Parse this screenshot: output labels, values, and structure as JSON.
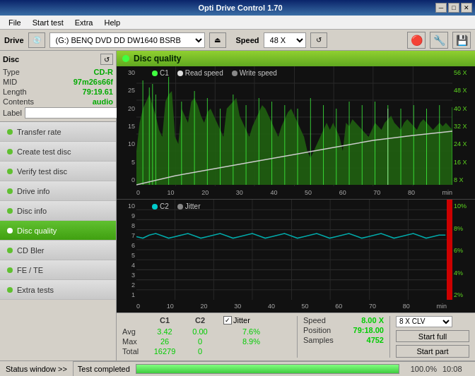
{
  "titleBar": {
    "title": "Opti Drive Control 1.70",
    "minBtn": "─",
    "maxBtn": "□",
    "closeBtn": "✕"
  },
  "menuBar": {
    "items": [
      "File",
      "Start test",
      "Extra",
      "Help"
    ]
  },
  "driveBar": {
    "driveLabel": "Drive",
    "driveValue": "(G:)  BENQ DVD DD DW1640 BSRB",
    "speedLabel": "Speed",
    "speedValue": "48 X"
  },
  "leftPanel": {
    "discSection": {
      "label": "Disc",
      "typeLabel": "Type",
      "typeValue": "CD-R",
      "midLabel": "MID",
      "midValue": "97m26s66f",
      "lengthLabel": "Length",
      "lengthValue": "79:19.61",
      "contentsLabel": "Contents",
      "contentsValue": "audio",
      "labelLabel": "Label",
      "labelValue": ""
    },
    "navItems": [
      {
        "label": "Transfer rate",
        "active": false
      },
      {
        "label": "Create test disc",
        "active": false
      },
      {
        "label": "Verify test disc",
        "active": false
      },
      {
        "label": "Drive info",
        "active": false
      },
      {
        "label": "Disc info",
        "active": false
      },
      {
        "label": "Disc quality",
        "active": true
      },
      {
        "label": "CD Bler",
        "active": false
      },
      {
        "label": "FE / TE",
        "active": false
      },
      {
        "label": "Extra tests",
        "active": false
      }
    ]
  },
  "chartArea": {
    "title": "Disc quality",
    "topChart": {
      "legend": [
        {
          "label": "C1",
          "color": "#40ff40"
        },
        {
          "label": "Read speed",
          "color": "#dddddd"
        },
        {
          "label": "Write speed",
          "color": "#888888"
        }
      ],
      "yLabels": [
        "30",
        "25",
        "20",
        "15",
        "10",
        "5",
        "0"
      ],
      "yRightLabels": [
        "56 X",
        "48 X",
        "40 X",
        "32 X",
        "24 X",
        "16 X",
        "8 X"
      ],
      "xLabels": [
        "0",
        "10",
        "20",
        "30",
        "40",
        "50",
        "60",
        "70",
        "80"
      ],
      "xUnit": "min"
    },
    "bottomChart": {
      "legend": [
        {
          "label": "C2",
          "color": "#00cccc"
        },
        {
          "label": "Jitter",
          "color": "#888888"
        }
      ],
      "yLabels": [
        "10",
        "9",
        "8",
        "7",
        "6",
        "5",
        "4",
        "3",
        "2",
        "1"
      ],
      "yRightLabels": [
        "10%",
        "8%",
        "6%",
        "4%",
        "2%"
      ],
      "xLabels": [
        "0",
        "10",
        "20",
        "30",
        "40",
        "50",
        "60",
        "70",
        "80"
      ],
      "xUnit": "min"
    }
  },
  "statsBar": {
    "headers": [
      "",
      "C1",
      "C2"
    ],
    "rows": [
      {
        "label": "Avg",
        "c1": "3.42",
        "c2": "0.00",
        "jitter": "7.6%"
      },
      {
        "label": "Max",
        "c1": "26",
        "c2": "0",
        "jitter": "8.9%"
      },
      {
        "label": "Total",
        "c1": "16279",
        "c2": "0",
        "jitter": ""
      }
    ],
    "jitterLabel": "Jitter",
    "jitterChecked": true,
    "speedLabel": "Speed",
    "speedValue": "8.00 X",
    "positionLabel": "Position",
    "positionValue": "79:18.00",
    "samplesLabel": "Samples",
    "samplesValue": "4752",
    "clvValue": "8 X CLV",
    "startFullLabel": "Start full",
    "startPartLabel": "Start part"
  },
  "statusBar": {
    "statusBtnLabel": "Status window >>",
    "statusText": "Test completed",
    "progressPercent": 100.0,
    "progressLabel": "100.0%",
    "timeLabel": "10:08"
  }
}
